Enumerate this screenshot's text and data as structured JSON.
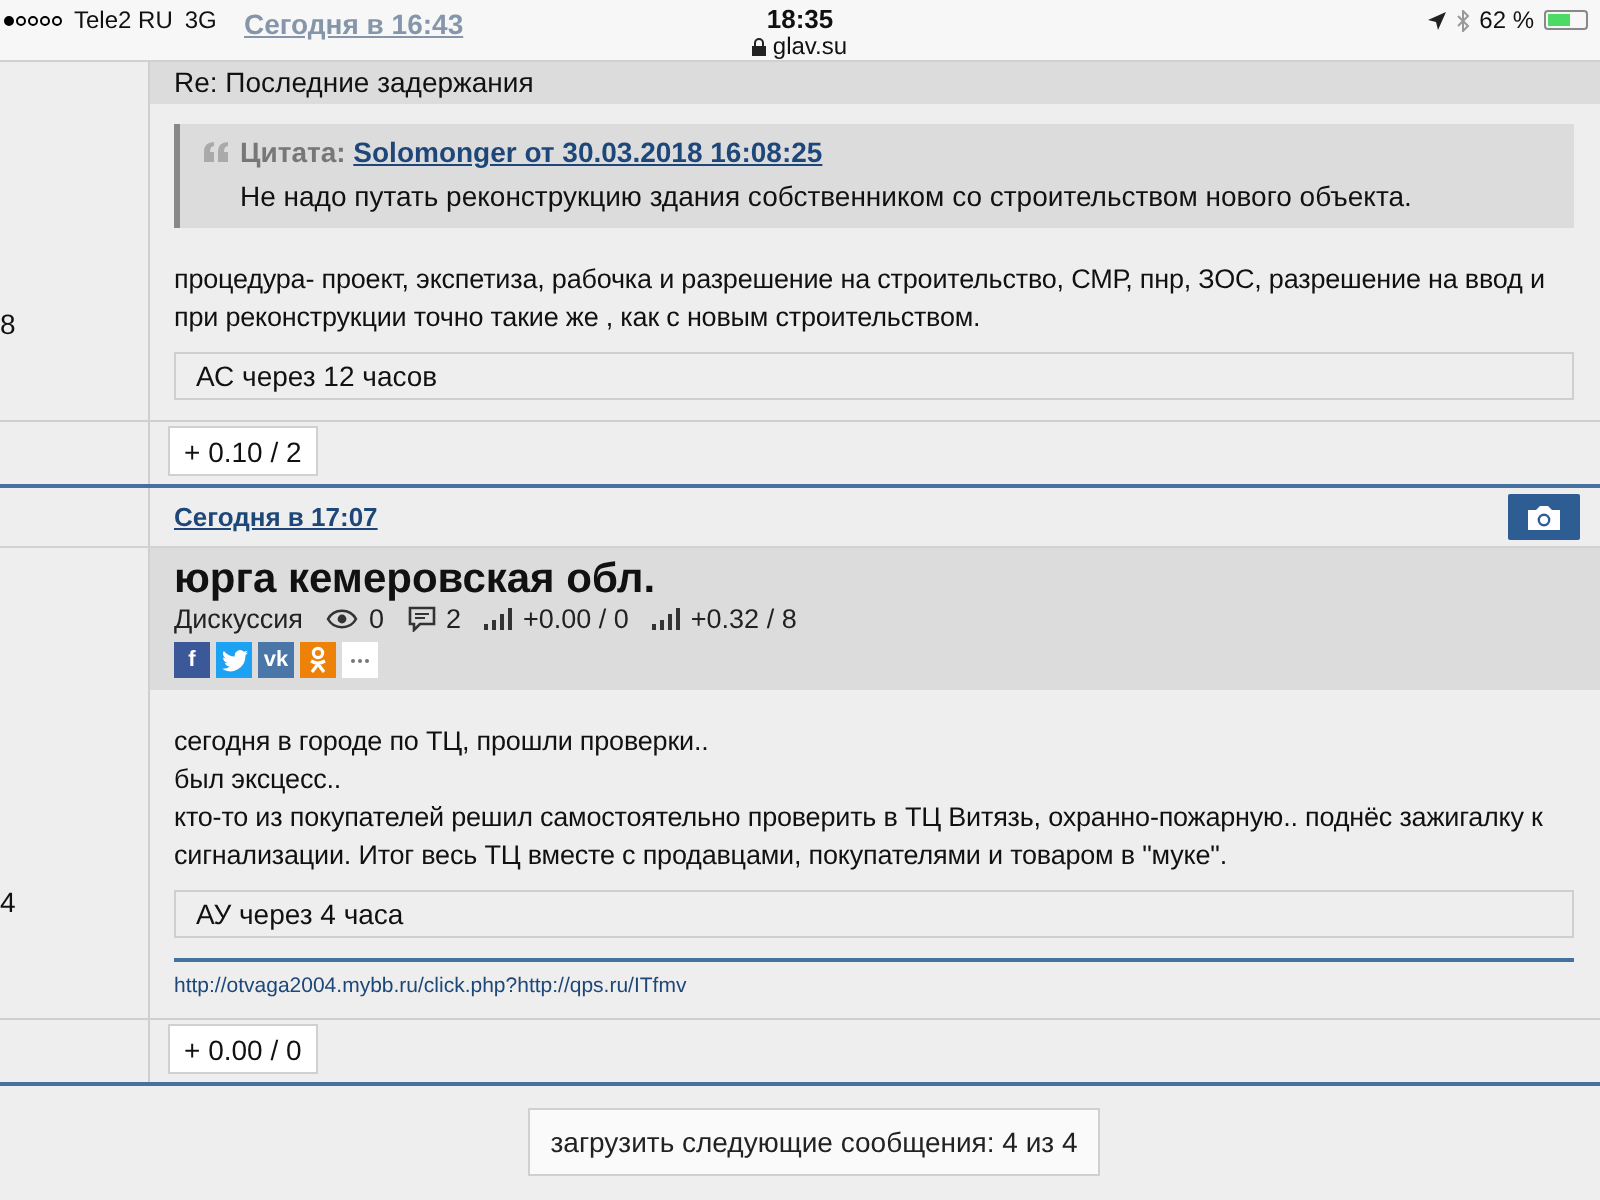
{
  "status_bar": {
    "carrier": "Tele2 RU",
    "network": "3G",
    "time": "18:35",
    "url": "glav.su",
    "battery": "62 %",
    "behind_link": "Сегодня в 16:43"
  },
  "posts": [
    {
      "number": "8",
      "title": "Re: Последние задержания",
      "quote": {
        "label": "Цитата:",
        "source": "Solomonger от 30.03.2018 16:08:25",
        "text": "Не надо путать реконструкцию здания собственником со строительством нового объекта."
      },
      "body": [
        "процедура- проект, экспетиза, рабочка и разрешение на строительство, СМР, пнр, ЗОС, разрешение на ввод и при реконструкции точно такие же , как с новым строительством."
      ],
      "signature": "АС через 12 часов",
      "rating": "+ 0.10 / 2"
    },
    {
      "number": "4",
      "date": "Сегодня в 17:07",
      "topic": {
        "title": "юрга кемеровская обл.",
        "category": "Дискуссия",
        "views": "0",
        "comments": "2",
        "rating_1": "+0.00 / 0",
        "rating_2": "+0.32 / 8"
      },
      "share": [
        {
          "kind": "facebook",
          "glyph": "f",
          "color": "#3b5998"
        },
        {
          "kind": "twitter",
          "color": "#1da1f2"
        },
        {
          "kind": "vk",
          "glyph": "vk",
          "color": "#4a76a8"
        },
        {
          "kind": "ok",
          "color": "#ee8208"
        },
        {
          "kind": "more"
        }
      ],
      "body": [
        "сегодня в городе по ТЦ, прошли проверки..",
        "был эксцесс..",
        "кто-то из покупателей решил самостоятельно проверить в ТЦ Витязь, охранно-пожарную.. поднёс зажигалку к сигнализации. Итог весь ТЦ вместе с продавцами, покупателями и товаром в \"муке\"."
      ],
      "signature": "АУ через 4 часа",
      "link": "http://otvaga2004.mybb.ru/click.php?http://qps.ru/ITfmv",
      "rating": "+ 0.00 / 0"
    }
  ],
  "load_more": "загрузить следующие сообщения: 4 из 4"
}
